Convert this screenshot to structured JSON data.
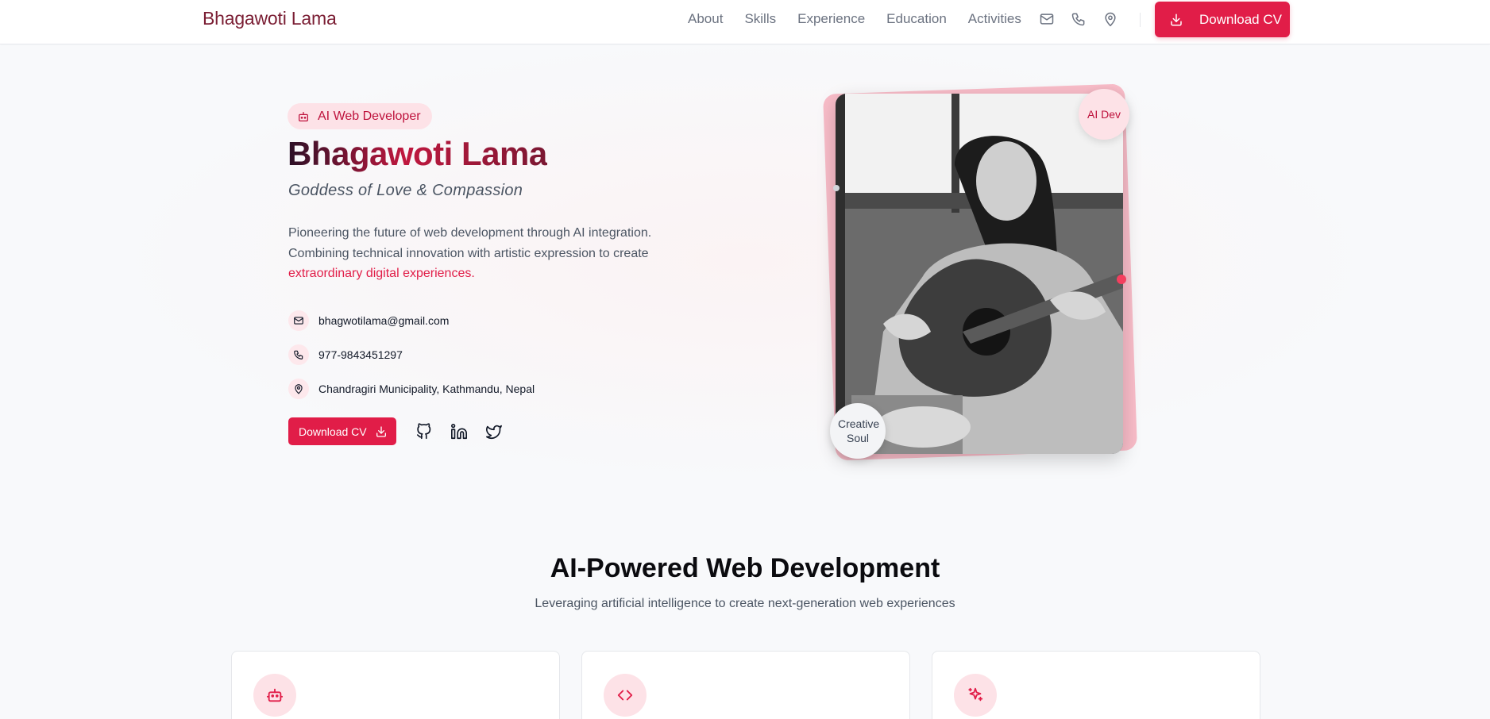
{
  "header": {
    "brand": "Bhagawoti Lama",
    "nav": [
      "About",
      "Skills",
      "Experience",
      "Education",
      "Activities"
    ],
    "download_label": "Download CV",
    "icons": [
      "mail-icon",
      "phone-icon",
      "map-pin-icon"
    ]
  },
  "hero": {
    "badge": "AI Web Developer",
    "name": "Bhagawoti Lama",
    "tagline": "Goddess of Love & Compassion",
    "intro_plain": "Pioneering the future of web development through AI integration. Combining technical innovation with artistic expression to create ",
    "intro_highlight": "extraordinary digital experiences.",
    "contacts": [
      {
        "icon": "mail-icon",
        "value": "bhagwotilama@gmail.com"
      },
      {
        "icon": "phone-icon",
        "value": "977-9843451297"
      },
      {
        "icon": "map-pin-icon",
        "value": "Chandragiri Municipality, Kathmandu, Nepal"
      }
    ],
    "download_label": "Download CV",
    "social": [
      "github-icon",
      "linkedin-icon",
      "twitter-icon"
    ],
    "float_top": "AI Dev",
    "float_bottom": "Creative Soul"
  },
  "section": {
    "title": "AI-Powered Web Development",
    "subtitle": "Leveraging artificial intelligence to create next-generation web experiences",
    "cards": [
      {
        "icon": "bot-icon"
      },
      {
        "icon": "code-icon"
      },
      {
        "icon": "sparkles-icon"
      }
    ]
  },
  "colors": {
    "accent": "#e11d48",
    "accent_soft": "#fde2e7",
    "brand_dark": "#7a1d33"
  }
}
